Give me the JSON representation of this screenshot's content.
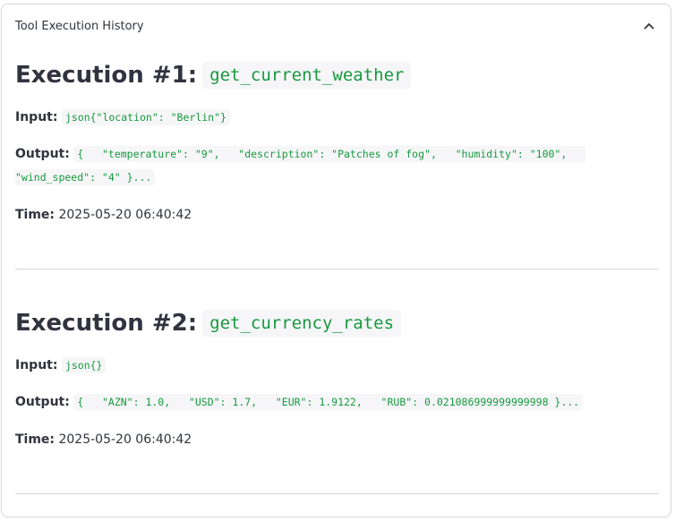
{
  "expander": {
    "title": "Tool Execution History",
    "collapse_icon": "chevron-up-icon"
  },
  "executions": [
    {
      "title": "Execution #1:",
      "tool": "get_current_weather",
      "input_label": "Input:",
      "input_value": "json{\"location\": \"Berlin\"}",
      "output_label": "Output:",
      "output_value": "{   \"temperature\": \"9\",   \"description\": \"Patches of fog\",   \"humidity\": \"100\",   \"wind_speed\": \"4\" }...",
      "time_label": "Time:",
      "time_value": "2025-05-20 06:40:42"
    },
    {
      "title": "Execution #2:",
      "tool": "get_currency_rates",
      "input_label": "Input:",
      "input_value": "json{}",
      "output_label": "Output:",
      "output_value": "{   \"AZN\": 1.0,   \"USD\": 1.7,   \"EUR\": 1.9122,   \"RUB\": 0.021086999999999998 }...",
      "time_label": "Time:",
      "time_value": "2025-05-20 06:40:42"
    }
  ],
  "colors": {
    "code_text": "#179a3e",
    "code_bg": "#f6f6f8",
    "border": "#d6d6d9",
    "text": "#31333f"
  }
}
